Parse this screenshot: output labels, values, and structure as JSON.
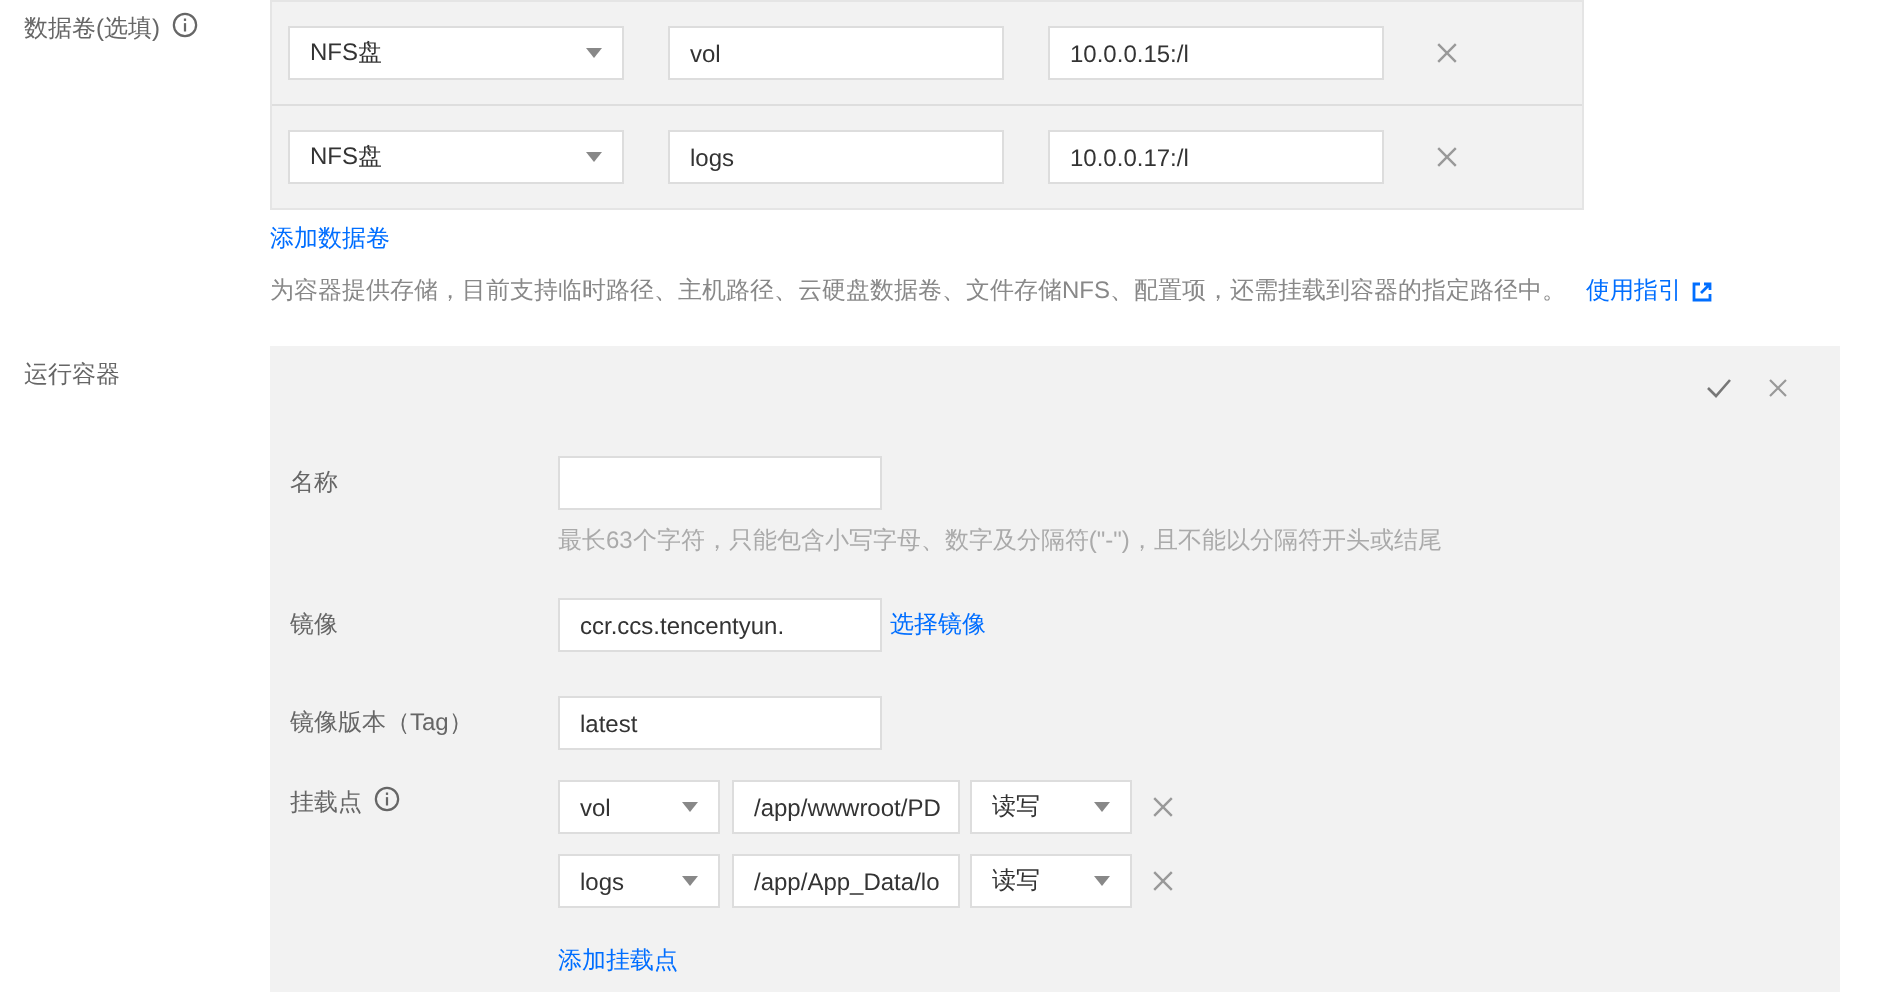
{
  "volumes": {
    "label": "数据卷(选填)",
    "rows": [
      {
        "type": "NFS盘",
        "name": "vol",
        "path": "10.0.0.15:/l"
      },
      {
        "type": "NFS盘",
        "name": "logs",
        "path": "10.0.0.17:/l"
      }
    ],
    "add_link": "添加数据卷",
    "hint": "为容器提供存储，目前支持临时路径、主机路径、云硬盘数据卷、文件存储NFS、配置项，还需挂载到容器的指定路径中。",
    "guide_link": "使用指引"
  },
  "container": {
    "label": "运行容器",
    "name": {
      "label": "名称",
      "hint": "最长63个字符，只能包含小写字母、数字及分隔符(\"-\")，且不能以分隔符开头或结尾"
    },
    "image": {
      "label": "镜像",
      "value": "ccr.ccs.tencentyun.",
      "link": "选择镜像"
    },
    "tag": {
      "label": "镜像版本（Tag）",
      "value": "latest"
    },
    "mounts": {
      "label": "挂载点",
      "rows": [
        {
          "volume": "vol",
          "path": "/app/wwwroot/PD",
          "mode": "读写"
        },
        {
          "volume": "logs",
          "path": "/app/App_Data/lo",
          "mode": "读写"
        }
      ],
      "add_link": "添加挂载点"
    }
  }
}
